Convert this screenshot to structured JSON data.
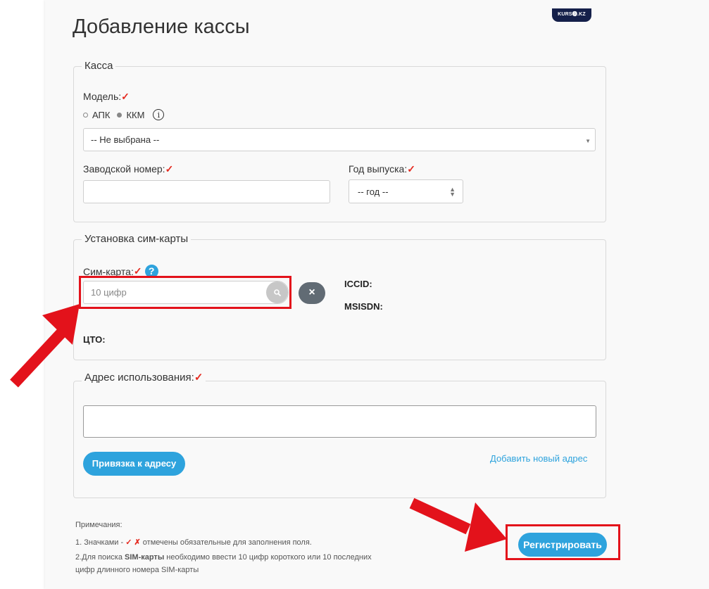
{
  "header": {
    "logo_text": "KURS⓿.KZ",
    "title": "Добавление кассы"
  },
  "kassa": {
    "legend": "Касса",
    "model_label": "Модель:",
    "required_mark": "✓",
    "radio_apk": "АПК",
    "radio_kkm": "ККМ",
    "radio_selected": "ККМ",
    "info_icon": "i",
    "model_select_value": "-- Не выбрана --",
    "serial_label": "Заводской номер:",
    "serial_value": "",
    "year_label": "Год выпуска:",
    "year_select_value": "-- год --"
  },
  "sim": {
    "legend": "Установка сим-карты",
    "sim_label": "Сим-карта:",
    "help_icon": "?",
    "input_placeholder": "10 цифр",
    "search_icon": "search-icon",
    "clear_icon": "×",
    "iccid_label": "ICCID:",
    "msisdn_label": "MSISDN:",
    "cto_label": "ЦТО:"
  },
  "address": {
    "legend": "Адрес использования:",
    "input_value": "",
    "bind_button": "Привязка к адресу",
    "add_link": "Добавить новый адрес"
  },
  "notes": {
    "title": "Примечания:",
    "line1_prefix": "1. Значками - ",
    "check_mark": "✓",
    "cross_mark": "✗",
    "line1_suffix": " отмечены обязательные для заполнения поля.",
    "line2_prefix": "2.Для поиска ",
    "line2_bold": "SIM-карты",
    "line2_suffix": " необходимо ввести 10 цифр короткого или 10 последних",
    "line3": "цифр длинного номера SIM-карты"
  },
  "register_button": "Регистрировать",
  "colors": {
    "accent": "#2ea3dd",
    "required": "#e52a1f",
    "highlight": "#e3121b",
    "logo_bg": "#15204a"
  }
}
